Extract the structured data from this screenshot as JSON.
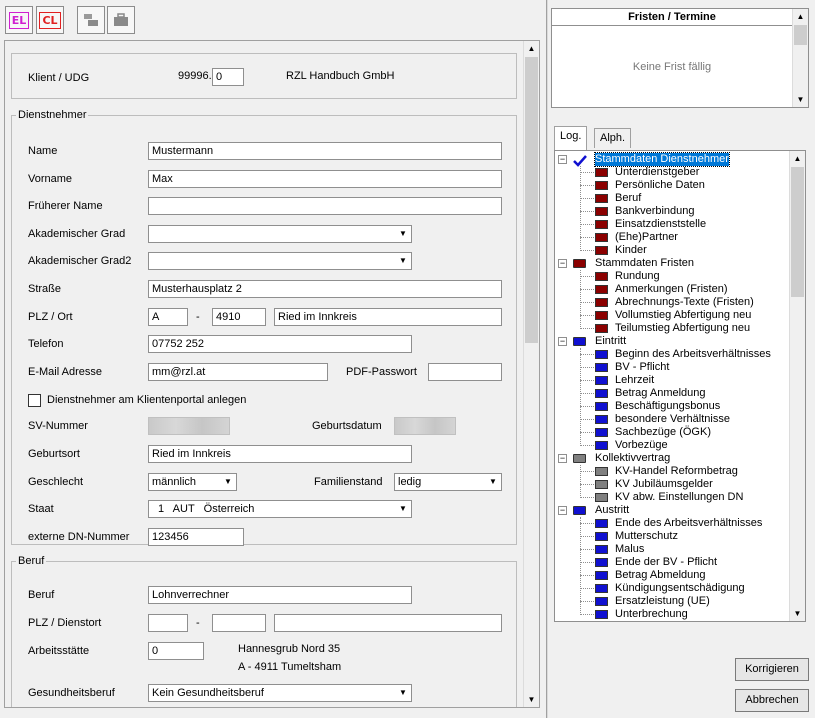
{
  "toolbar": {
    "el_label": "EL",
    "cl_label": "CL",
    "colors": {
      "el": "#d020d0",
      "cl": "#e02020"
    }
  },
  "client": {
    "label": "Klient / UDG",
    "number": "99996.",
    "sub_value": "0",
    "name": "RZL Handbuch GmbH"
  },
  "employee": {
    "legend": "Dienstnehmer",
    "surname_label": "Name",
    "surname": "Mustermann",
    "firstname_label": "Vorname",
    "firstname": "Max",
    "former_name_label": "Früherer Name",
    "former_name": "",
    "degree_label": "Akademischer Grad",
    "degree": "",
    "degree2_label": "Akademischer Grad2",
    "degree2": "",
    "street_label": "Straße",
    "street": "Musterhausplatz 2",
    "zip_city_label": "PLZ / Ort",
    "country_code": "A",
    "zip_sep": "-",
    "zip": "4910",
    "city": "Ried im Innkreis",
    "phone_label": "Telefon",
    "phone": "07752 252",
    "email_label": "E-Mail Adresse",
    "email": "mm@rzl.at",
    "pdf_password_label": "PDF-Passwort",
    "pdf_password": "",
    "portal_checkbox_label": "Dienstnehmer am Klientenportal anlegen",
    "sv_label": "SV-Nummer",
    "birthdate_label": "Geburtsdatum",
    "birthplace_label": "Geburtsort",
    "birthplace": "Ried im Innkreis",
    "gender_label": "Geschlecht",
    "gender": "männlich",
    "marital_label": "Familienstand",
    "marital": "ledig",
    "country_label": "Staat",
    "country": "1   AUT   Österreich",
    "external_no_label": "externe DN-Nummer",
    "external_no": "123456"
  },
  "job": {
    "legend": "Beruf",
    "job_label": "Beruf",
    "job": "Lohnverrechner",
    "zip_place_label": "PLZ / Dienstort",
    "zip_sep": "-",
    "zip_a": "",
    "zip_b": "",
    "place": "",
    "workplace_label": "Arbeitsstätte",
    "workplace": "0",
    "workplace_addr1": "Hannesgrub Nord 35",
    "workplace_addr2": "A - 4911 Tumeltsham",
    "health_label": "Gesundheitsberuf",
    "health": "Kein Gesundheitsberuf"
  },
  "deadlines": {
    "title": "Fristen / Termine",
    "empty_text": "Keine Frist fällig"
  },
  "tabs": [
    "Log.",
    "Alph."
  ],
  "tree": [
    {
      "label": "Stammdaten Dienstnehmer",
      "icon": "person-check-icon",
      "selected": true,
      "children": [
        "Unterdienstgeber",
        "Persönliche Daten",
        "Beruf",
        "Bankverbindung",
        "Einsatzdienststelle",
        "(Ehe)Partner",
        "Kinder"
      ]
    },
    {
      "label": "Stammdaten Fristen",
      "icon": "folder-icon",
      "color": "#8b0000",
      "children": [
        "Rundung",
        "Anmerkungen (Fristen)",
        "Abrechnungs-Texte (Fristen)",
        "Vollumstieg Abfertigung neu",
        "Teilumstieg Abfertigung neu"
      ]
    },
    {
      "label": "Eintritt",
      "icon": "folder-icon",
      "color": "#1010d0",
      "children": [
        "Beginn des Arbeitsverhältnisses",
        "BV - Pflicht",
        "Lehrzeit",
        "Betrag Anmeldung",
        "Beschäftigungsbonus",
        "besondere Verhältnisse",
        "Sachbezüge (ÖGK)",
        "Vorbezüge"
      ]
    },
    {
      "label": "Kollektivvertrag",
      "icon": "folder-icon",
      "color": "#808080",
      "children": [
        "KV-Handel Reformbetrag",
        "KV Jubiläumsgelder",
        "KV abw. Einstellungen DN"
      ]
    },
    {
      "label": "Austritt",
      "icon": "folder-icon",
      "color": "#1010d0",
      "children": [
        "Ende des Arbeitsverhältnisses",
        "Mutterschutz",
        "Malus",
        "Ende der BV - Pflicht",
        "Betrag Abmeldung",
        "Kündigungsentschädigung",
        "Ersatzleistung (UE)",
        "Unterbrechung"
      ]
    }
  ],
  "buttons": {
    "correct": "Korrigieren",
    "cancel": "Abbrechen"
  }
}
